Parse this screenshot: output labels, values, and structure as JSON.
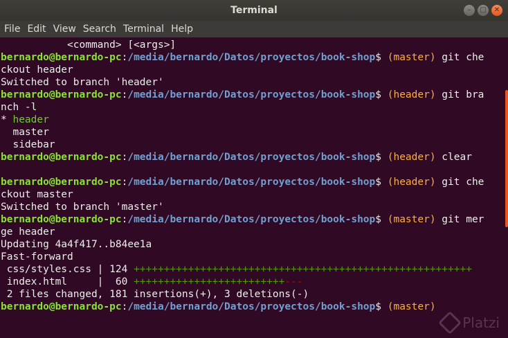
{
  "window": {
    "title": "Terminal"
  },
  "menubar": {
    "items": [
      "File",
      "Edit",
      "View",
      "Search",
      "Terminal",
      "Help"
    ]
  },
  "prompt": {
    "user": "bernardo@bernardo-pc",
    "path": "/media/bernardo/Datos/proyectos/book-shop"
  },
  "lines": {
    "l0": "           <command> [<args>]",
    "l1_branch": "(master)",
    "l1_cmd": " git che",
    "l2": "ckout header",
    "l3": "Switched to branch 'header'",
    "l4_branch": "(header)",
    "l4_cmd": " git bra",
    "l5": "nch -l",
    "l6_star": "* ",
    "l6_cur": "header",
    "l7": "  master",
    "l8": "  sidebar",
    "l9_branch": "(header)",
    "l9_cmd": " clear",
    "l11_branch": "(header)",
    "l11_cmd": " git che",
    "l12": "ckout master",
    "l13": "Switched to branch 'master'",
    "l14_branch": "(master)",
    "l14_cmd": " git mer",
    "l15": "ge header",
    "l16": "Updating 4a4f417..b84ee1a",
    "l17": "Fast-forward",
    "l18_text": " css/styles.css | 124 ",
    "l18_plus": "++++++++++++++++++++++++++++++++++++++++++++++++++++++++",
    "l19_text": " index.html     |  60 ",
    "l19_plus": "+++++++++++++++++++++++++",
    "l19_minus": "---",
    "l20": " 2 files changed, 181 insertions(+), 3 deletions(-)",
    "l21_branch": "(master)"
  },
  "watermark": {
    "text": "Platzi"
  },
  "colors": {
    "bg": "#300a24",
    "user": "#8ae234",
    "path": "#729fcf",
    "branch": "#fcaf3e",
    "plus": "#4e9a06",
    "minus": "#cc0000",
    "accent": "#e95420"
  }
}
